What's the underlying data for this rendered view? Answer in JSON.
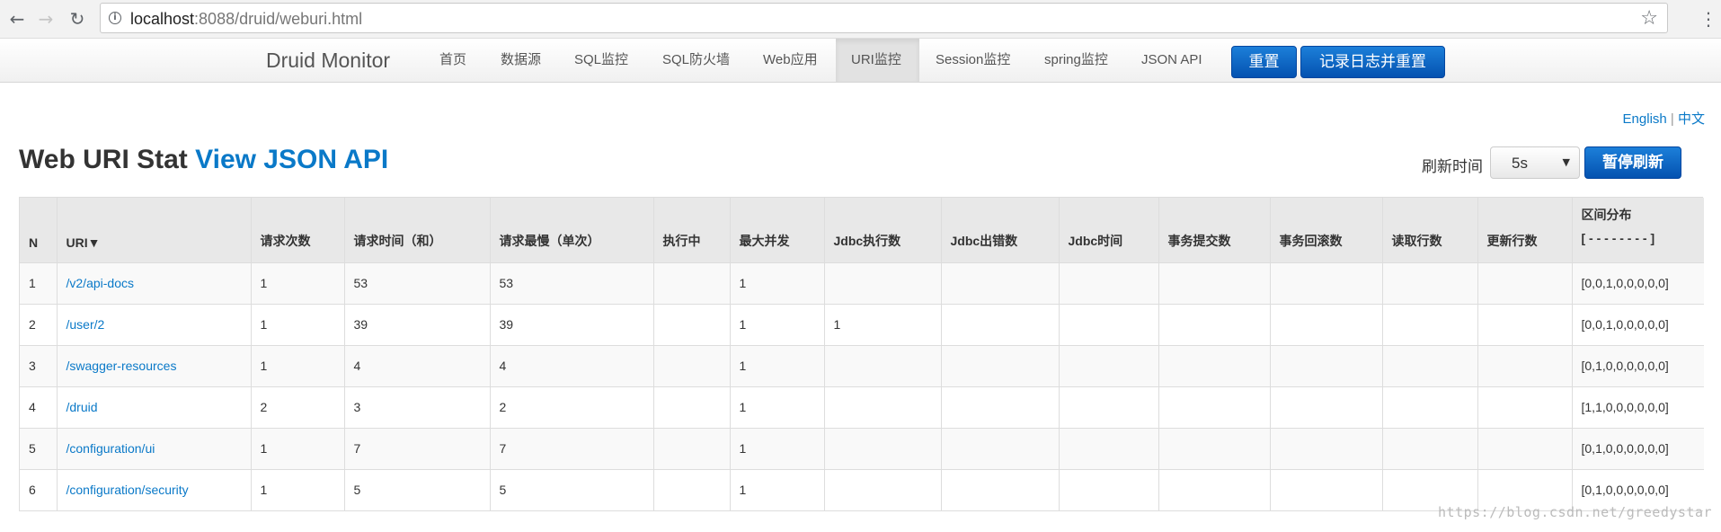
{
  "browser": {
    "url_host": "localhost",
    "url_rest": ":8088/druid/weburi.html",
    "back_icon": "←",
    "forward_icon": "→",
    "reload_icon": "↻",
    "info_icon": "i",
    "star_icon": "☆",
    "menu_icon": "⋮"
  },
  "navbar": {
    "brand": "Druid Monitor",
    "items": [
      "首页",
      "数据源",
      "SQL监控",
      "SQL防火墙",
      "Web应用",
      "URI监控",
      "Session监控",
      "spring监控",
      "JSON API"
    ],
    "active_item": "URI监控",
    "reset_button": "重置",
    "log_reset_button": "记录日志并重置"
  },
  "lang": {
    "english": "English",
    "sep": " | ",
    "chinese": "中文"
  },
  "page": {
    "title": "Web URI Stat",
    "title_link": "View JSON API",
    "refresh_label": "刷新时间",
    "refresh_value": "5s",
    "pause_button": "暂停刷新"
  },
  "table": {
    "headers": [
      "N",
      "URI▼",
      "请求次数",
      "请求时间（和）",
      "请求最慢（单次）",
      "执行中",
      "最大并发",
      "Jdbc执行数",
      "Jdbc出错数",
      "Jdbc时间",
      "事务提交数",
      "事务回滚数",
      "读取行数",
      "更新行数",
      "区间分布",
      "[ - - - - - - - - ]"
    ],
    "rows": [
      [
        "1",
        "/v2/api-docs",
        "1",
        "53",
        "53",
        "",
        "1",
        "",
        "",
        "",
        "",
        "",
        "",
        "",
        "[0,0,1,0,0,0,0,0]"
      ],
      [
        "2",
        "/user/2",
        "1",
        "39",
        "39",
        "",
        "1",
        "1",
        "",
        "",
        "",
        "",
        "",
        "",
        "[0,0,1,0,0,0,0,0]"
      ],
      [
        "3",
        "/swagger-resources",
        "1",
        "4",
        "4",
        "",
        "1",
        "",
        "",
        "",
        "",
        "",
        "",
        "",
        "[0,1,0,0,0,0,0,0]"
      ],
      [
        "4",
        "/druid",
        "2",
        "3",
        "2",
        "",
        "1",
        "",
        "",
        "",
        "",
        "",
        "",
        "",
        "[1,1,0,0,0,0,0,0]"
      ],
      [
        "5",
        "/configuration/ui",
        "1",
        "7",
        "7",
        "",
        "1",
        "",
        "",
        "",
        "",
        "",
        "",
        "",
        "[0,1,0,0,0,0,0,0]"
      ],
      [
        "6",
        "/configuration/security",
        "1",
        "5",
        "5",
        "",
        "1",
        "",
        "",
        "",
        "",
        "",
        "",
        "",
        "[0,1,0,0,0,0,0,0]"
      ]
    ]
  },
  "watermark": "https://blog.csdn.net/greedystar"
}
